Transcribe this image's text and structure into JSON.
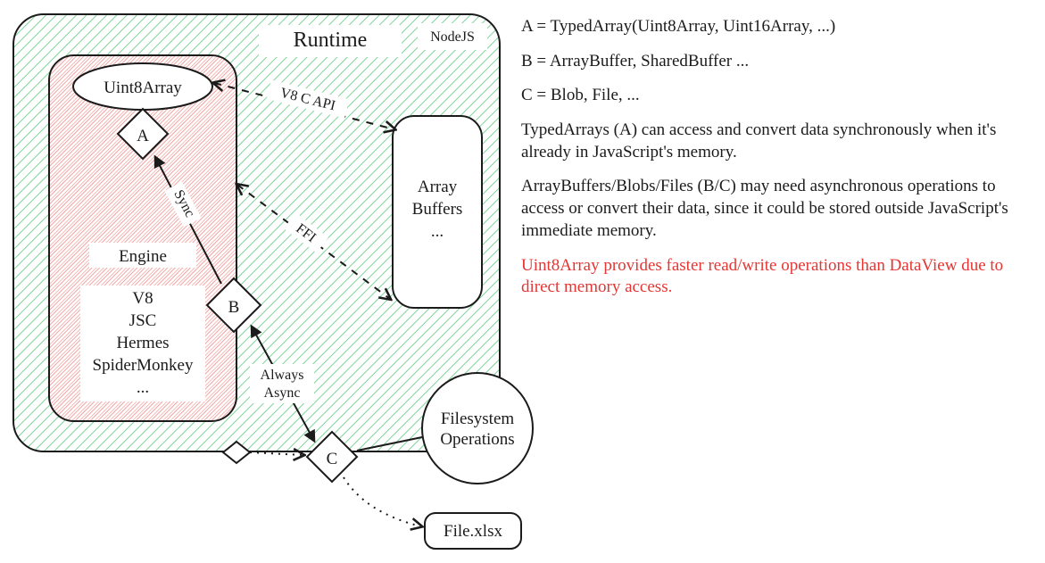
{
  "runtime": {
    "title": "Runtime",
    "badge": "NodeJS"
  },
  "engine": {
    "title": "Engine",
    "list": [
      "V8",
      "JSC",
      "Hermes",
      "SpiderMonkey",
      "..."
    ]
  },
  "nodes": {
    "uint8": "Uint8Array",
    "A": "A",
    "B": "B",
    "C": "C",
    "arrayBuffers": "Array\nBuffers\n...",
    "fsOps": "Filesystem\nOperations",
    "file": "File.xlsx"
  },
  "edgeLabels": {
    "sync": "Sync",
    "alwaysAsync": "Always\nAsync",
    "v8capi": "V8 C API",
    "ffi": "FFI"
  },
  "legend": {
    "a": "A = TypedArray(Uint8Array, Uint16Array, ...)",
    "b": "B = ArrayBuffer, SharedBuffer ...",
    "c": "C = Blob, File, ...",
    "p1": "TypedArrays (A) can access and convert data synchronously when it's already in JavaScript's memory.",
    "p2": "ArrayBuffers/Blobs/Files (B/C) may need asynchronous operations to access or convert their data, since it could be stored outside JavaScript's immediate memory.",
    "p3": "Uint8Array provides faster read/write operations than DataView due to direct memory access."
  }
}
